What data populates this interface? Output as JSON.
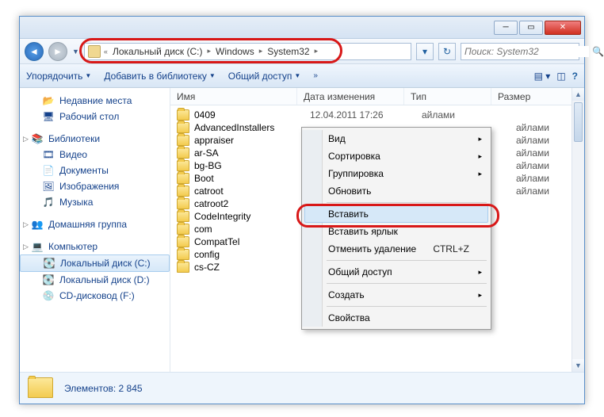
{
  "breadcrumb": {
    "root": "Локальный диск (C:)",
    "lvl1": "Windows",
    "lvl2": "System32"
  },
  "search": {
    "placeholder": "Поиск: System32"
  },
  "cmdbar": {
    "organize": "Упорядочить",
    "addlib": "Добавить в библиотеку",
    "share": "Общий доступ"
  },
  "sidebar": {
    "recent": "Недавние места",
    "desktop": "Рабочий стол",
    "libraries": "Библиотеки",
    "videos": "Видео",
    "documents": "Документы",
    "pictures": "Изображения",
    "music": "Музыка",
    "homegroup": "Домашняя группа",
    "computer": "Компьютер",
    "diskC": "Локальный диск (C:)",
    "diskD": "Локальный диск (D:)",
    "cdF": "CD-дисковод (F:)"
  },
  "columns": {
    "name": "Имя",
    "date": "Дата изменения",
    "type": "Тип",
    "size": "Размер"
  },
  "files": {
    "f0": "0409",
    "f1": "AdvancedInstallers",
    "f2": "appraiser",
    "f3": "ar-SA",
    "f4": "bg-BG",
    "f5": "Boot",
    "f6": "catroot",
    "f7": "catroot2",
    "f8": "CodeIntegrity",
    "f9": "com",
    "f10": "CompatTel",
    "f11": "config",
    "f12": "cs-CZ"
  },
  "filedate": "12.04.2011 17:26",
  "filetype_partial": "айлами",
  "ctx": {
    "view": "Вид",
    "sort": "Сортировка",
    "group": "Группировка",
    "refresh": "Обновить",
    "paste": "Вставить",
    "paste_shortcut": "Вставить ярлык",
    "undo": "Отменить удаление",
    "undo_key": "CTRL+Z",
    "share": "Общий доступ",
    "new": "Создать",
    "props": "Свойства"
  },
  "status": {
    "elements": "Элементов: 2 845"
  }
}
